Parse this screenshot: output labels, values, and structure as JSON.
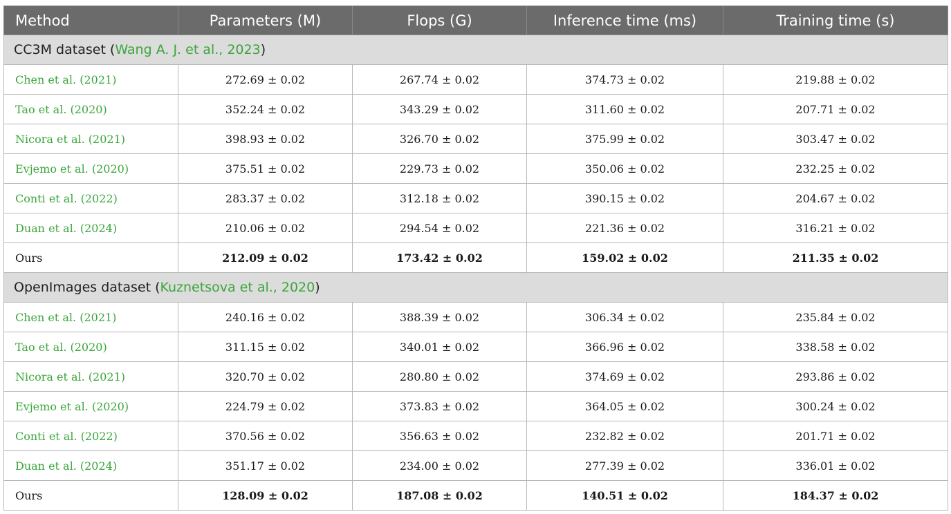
{
  "headers": [
    "Method",
    "Parameters (M)",
    "Flops (G)",
    "Inference time (ms)",
    "Training time (s)"
  ],
  "sections": [
    {
      "title_prefix": "CC3M dataset (",
      "title_link": "Wang A. J. et al., 2023",
      "title_suffix": ")",
      "rows": [
        {
          "method": "Chen et al. (2021)",
          "values": [
            "272.69 ± 0.02",
            "267.74 ± 0.02",
            "374.73 ± 0.02",
            "219.88 ± 0.02"
          ]
        },
        {
          "method": "Tao et al. (2020)",
          "values": [
            "352.24 ± 0.02",
            "343.29 ± 0.02",
            "311.60 ± 0.02",
            "207.71 ± 0.02"
          ]
        },
        {
          "method": "Nicora et al. (2021)",
          "values": [
            "398.93 ± 0.02",
            "326.70 ± 0.02",
            "375.99 ± 0.02",
            "303.47 ± 0.02"
          ]
        },
        {
          "method": "Evjemo et al. (2020)",
          "values": [
            "375.51 ± 0.02",
            "229.73 ± 0.02",
            "350.06 ± 0.02",
            "232.25 ± 0.02"
          ]
        },
        {
          "method": "Conti et al. (2022)",
          "values": [
            "283.37 ± 0.02",
            "312.18 ± 0.02",
            "390.15 ± 0.02",
            "204.67 ± 0.02"
          ]
        },
        {
          "method": "Duan et al. (2024)",
          "values": [
            "210.06 ± 0.02",
            "294.54 ± 0.02",
            "221.36 ± 0.02",
            "316.21 ± 0.02"
          ]
        },
        {
          "method": "Ours",
          "values": [
            "212.09 ± 0.02",
            "173.42 ± 0.02",
            "159.02 ± 0.02",
            "211.35 ± 0.02"
          ]
        }
      ]
    },
    {
      "title_prefix": "OpenImages dataset (",
      "title_link": "Kuznetsova et al., 2020",
      "title_suffix": ")",
      "rows": [
        {
          "method": "Chen et al. (2021)",
          "values": [
            "240.16 ± 0.02",
            "388.39 ± 0.02",
            "306.34 ± 0.02",
            "235.84 ± 0.02"
          ]
        },
        {
          "method": "Tao et al. (2020)",
          "values": [
            "311.15 ± 0.02",
            "340.01 ± 0.02",
            "366.96 ± 0.02",
            "338.58 ± 0.02"
          ]
        },
        {
          "method": "Nicora et al. (2021)",
          "values": [
            "320.70 ± 0.02",
            "280.80 ± 0.02",
            "374.69 ± 0.02",
            "293.86 ± 0.02"
          ]
        },
        {
          "method": "Evjemo et al. (2020)",
          "values": [
            "224.79 ± 0.02",
            "373.83 ± 0.02",
            "364.05 ± 0.02",
            "300.24 ± 0.02"
          ]
        },
        {
          "method": "Conti et al. (2022)",
          "values": [
            "370.56 ± 0.02",
            "356.63 ± 0.02",
            "232.82 ± 0.02",
            "201.71 ± 0.02"
          ]
        },
        {
          "method": "Duan et al. (2024)",
          "values": [
            "351.17 ± 0.02",
            "234.00 ± 0.02",
            "277.39 ± 0.02",
            "336.01 ± 0.02"
          ]
        },
        {
          "method": "Ours",
          "values": [
            "128.09 ± 0.02",
            "187.08 ± 0.02",
            "140.51 ± 0.02",
            "184.37 ± 0.02"
          ]
        }
      ]
    }
  ],
  "colors": {
    "header_bg": "#6b6b6b",
    "section_bg": "#dcdcdc",
    "link": "#3aa63a"
  }
}
